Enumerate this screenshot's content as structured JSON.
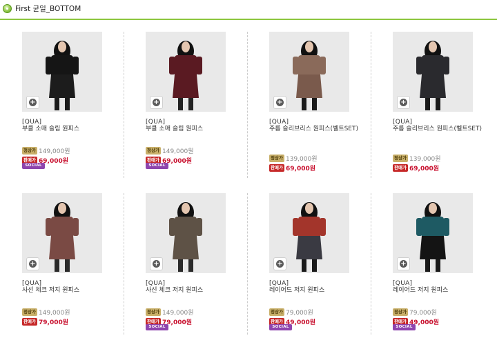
{
  "header": {
    "title": "First 균일_BOTTOM"
  },
  "tags": {
    "regular": "정상가",
    "sale": "판매가",
    "social": "SOCIAL"
  },
  "products": [
    {
      "brand": "[QUA]",
      "name": "부클 소매 슬림 원피스",
      "regular_price": "149,000원",
      "sale_price": "69,000원",
      "social": true,
      "colors": {
        "bg": "#e9e9e9",
        "top": "#151515",
        "skirt": "#1c1c1c",
        "hair": "#111111",
        "legs": "#1a1a1a"
      }
    },
    {
      "brand": "[QUA]",
      "name": "부클 소매 슬림 원피스",
      "regular_price": "149,000원",
      "sale_price": "69,000원",
      "social": true,
      "colors": {
        "bg": "#e9e9e9",
        "top": "#5a1a22",
        "skirt": "#5a1a22",
        "hair": "#111111",
        "legs": "#222222"
      }
    },
    {
      "brand": "[QUA]",
      "name": "주름 슬리브리스 원피스(벨트SET)",
      "regular_price": "139,000원",
      "sale_price": "69,000원",
      "social": false,
      "colors": {
        "bg": "#e9e9e9",
        "top": "#8a6a5a",
        "skirt": "#7a5a4c",
        "hair": "#111111",
        "legs": "#1a1a1a"
      }
    },
    {
      "brand": "[QUA]",
      "name": "주름 슬리브리스 원피스(벨트SET)",
      "regular_price": "139,000원",
      "sale_price": "69,000원",
      "social": false,
      "colors": {
        "bg": "#e9e9e9",
        "top": "#2a2a2e",
        "skirt": "#2a2a2e",
        "hair": "#111111",
        "legs": "#1a1a1a"
      }
    },
    {
      "brand": "[QUA]",
      "name": "사선 체크 저지 원피스",
      "regular_price": "149,000원",
      "sale_price": "79,000원",
      "social": false,
      "colors": {
        "bg": "#e9e9e9",
        "top": "#7a4a44",
        "skirt": "#7a4a44",
        "hair": "#111111",
        "legs": "#2a2a2a"
      }
    },
    {
      "brand": "[QUA]",
      "name": "사선 체크 저지 원피스",
      "regular_price": "149,000원",
      "sale_price": "79,000원",
      "social": true,
      "colors": {
        "bg": "#e9e9e9",
        "top": "#5e5246",
        "skirt": "#5e5246",
        "hair": "#111111",
        "legs": "#2a2a2a"
      }
    },
    {
      "brand": "[QUA]",
      "name": "레이어드 저지 원피스",
      "regular_price": "79,000원",
      "sale_price": "49,000원",
      "social": true,
      "colors": {
        "bg": "#e9e9e9",
        "top": "#a3352b",
        "skirt": "#3a3a42",
        "hair": "#111111",
        "legs": "#1a1a1a"
      }
    },
    {
      "brand": "[QUA]",
      "name": "레이어드 저지 원피스",
      "regular_price": "79,000원",
      "sale_price": "49,000원",
      "social": true,
      "colors": {
        "bg": "#e9e9e9",
        "top": "#1e5a63",
        "skirt": "#141414",
        "hair": "#111111",
        "legs": "#1a1a1a"
      }
    }
  ]
}
